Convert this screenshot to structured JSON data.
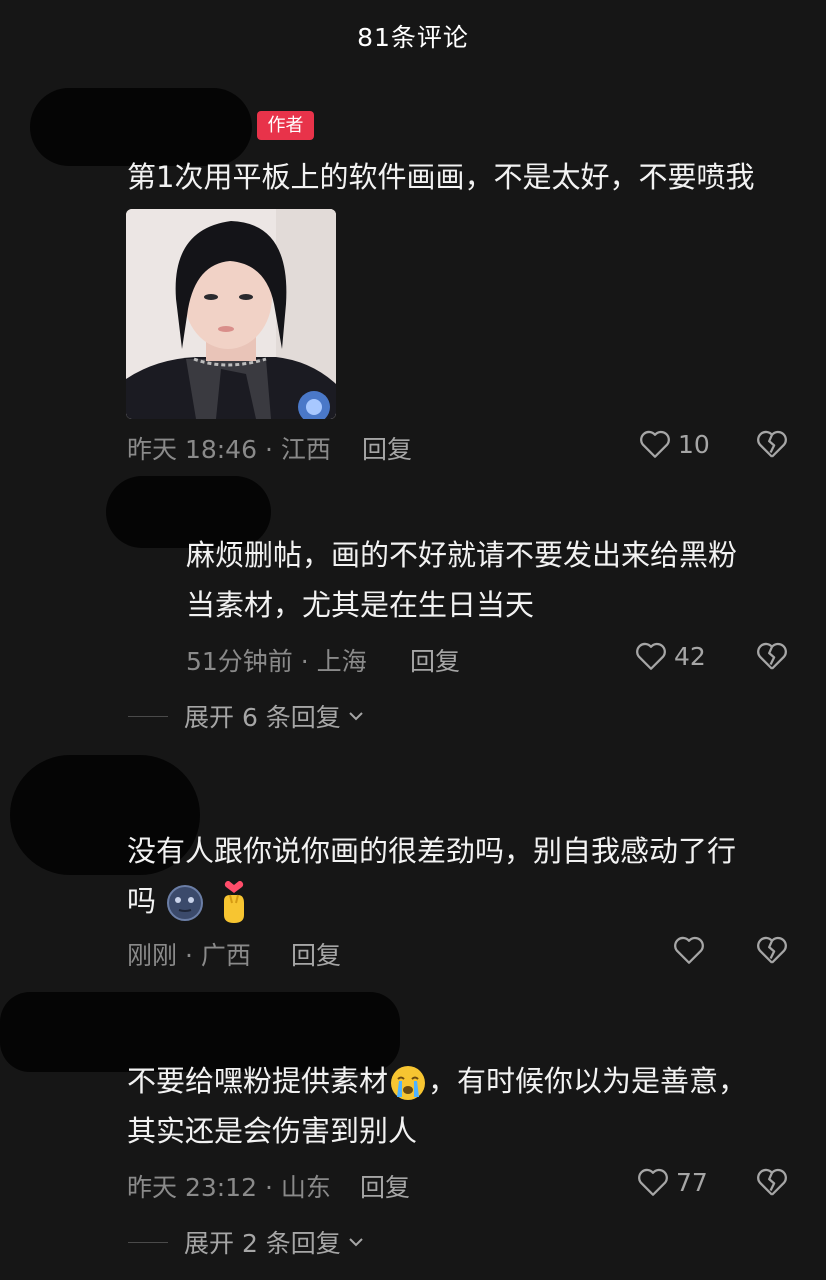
{
  "header": {
    "title": "81条评论"
  },
  "comments": [
    {
      "author_badge": "作者",
      "text_lines": [
        "第1次用平板上的软件画画，不是太好，不要喷我"
      ],
      "meta": "昨天 18:46 · 江西",
      "reply_label": "回复",
      "likes": "10"
    },
    {
      "text_lines": [
        "麻烦删帖，画的不好就请不要发出来给黑粉",
        "当素材，尤其是在生日当天"
      ],
      "meta": "51分钟前 · 上海",
      "reply_label": "回复",
      "likes": "42",
      "expand_label": "展开 6 条回复"
    },
    {
      "text_lines": [
        "没有人跟你说你画的很差劲吗，别自我感动了行",
        "吗"
      ],
      "emojis": [
        "moon-face-emoji",
        "finger-heart-emoji"
      ],
      "meta": "刚刚 · 广西",
      "reply_label": "回复",
      "likes": ""
    },
    {
      "text_lines": [
        "不要给嘿粉提供素材",
        "，有时候你以为是善意，",
        "其实还是会伤害到别人"
      ],
      "emojis": [
        "crying-emoji"
      ],
      "meta": "昨天 23:12 · 山东",
      "reply_label": "回复",
      "likes": "77",
      "expand_label": "展开 2 条回复"
    }
  ],
  "colors": {
    "background": "#161616",
    "badge": "#e8334a",
    "meta": "#8a8a8a"
  }
}
